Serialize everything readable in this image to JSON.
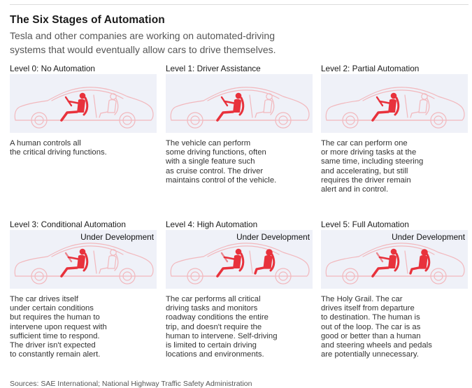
{
  "title": "The Six Stages of Automation",
  "subtitle": "Tesla and other companies are working on automated-driving systems that would eventually allow cars to drive themselves.",
  "colors": {
    "car_outline": "#f2b8bd",
    "occupant": "#e8323c",
    "panel_bg": "#eff1f8"
  },
  "stages": [
    {
      "label": "Level 0: No Automation",
      "badge": "",
      "highlight": "driver",
      "description_lines": [
        "A human controls all",
        "the critical driving functions."
      ]
    },
    {
      "label": "Level 1: Driver Assistance",
      "badge": "",
      "highlight": "driver",
      "description_lines": [
        "The vehicle can perform",
        "some driving functions, often",
        "with a single feature such",
        "as cruise control. The driver",
        "maintains control of the vehicle."
      ]
    },
    {
      "label": "Level 2: Partial Automation",
      "badge": "",
      "highlight": "driver",
      "description_lines": [
        "The car can perform one",
        "or more driving tasks at the",
        "same time, including steering",
        "and accelerating, but still",
        "requires the driver remain",
        "alert and in control."
      ]
    },
    {
      "label": "Level 3: Conditional Automation",
      "badge": "Under Development",
      "highlight": "driver",
      "description_lines": [
        "The car drives itself",
        "under certain conditions",
        "but requires the human to",
        "intervene upon request with",
        "sufficient time to respond.",
        "The driver isn't expected",
        "to constantly remain alert."
      ]
    },
    {
      "label": "Level 4: High Automation",
      "badge": "Under Development",
      "highlight": "both",
      "description_lines": [
        "The car performs all critical",
        "driving tasks and monitors",
        "roadway conditions the entire",
        "trip, and doesn't require the",
        "human to intervene. Self-driving",
        "is limited to certain driving",
        "locations and environments."
      ]
    },
    {
      "label": "Level 5: Full Automation",
      "badge": "Under Development",
      "highlight": "both",
      "description_lines": [
        "The Holy Grail. The car",
        "drives itself from departure",
        "to destination. The human is",
        "out of the loop. The car is as",
        "good or better than a human",
        "and steering wheels and pedals",
        "are potentially unnecessary."
      ]
    }
  ],
  "source": "Sources: SAE International; National Highway Traffic Safety Administration"
}
